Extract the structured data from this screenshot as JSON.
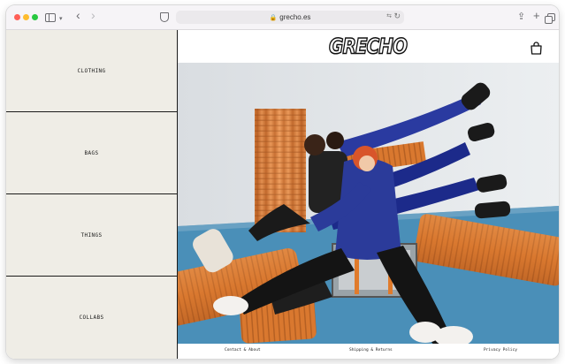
{
  "browser": {
    "url": "grecho.es",
    "icons": [
      "sidebar-icon",
      "chevron-down-icon",
      "back-arrow-icon",
      "forward-arrow-icon",
      "shield-icon",
      "lock-icon",
      "translate-icon",
      "reload-icon",
      "share-icon",
      "plus-icon",
      "tabs-icon"
    ]
  },
  "site": {
    "logo": "GRECHO",
    "nav": [
      "CLOTHING",
      "BAGS",
      "THINGS",
      "COLLABS"
    ],
    "footer": {
      "contact": "Contact & About",
      "shipping": "Shipping & Returns",
      "privacy": "Privacy Policy"
    }
  },
  "colors": {
    "nav_bg": "#efede6",
    "pipe_orange": "#d97a38",
    "floor_blue": "#4a8fb8",
    "jacket_blue": "#2f3f9e"
  }
}
